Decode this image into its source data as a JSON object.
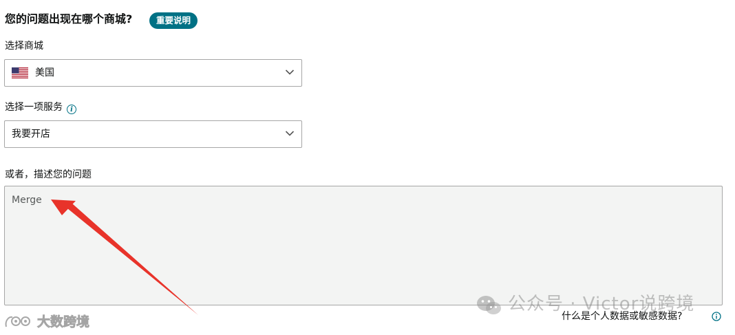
{
  "header": {
    "question": "您的问题出现在哪个商城?",
    "important_button": "重要说明"
  },
  "store": {
    "label": "选择商城",
    "selected": "美国",
    "flag_icon": "us-flag-icon"
  },
  "service": {
    "label": "选择一项服务",
    "selected": "我要开店",
    "info_icon": "info-icon"
  },
  "description": {
    "label": "或者，描述您的问题",
    "value": "Merge"
  },
  "footer": {
    "privacy_link": "什么是个人数据或敏感数据?"
  },
  "watermarks": {
    "wechat": "公众号 · Victor说跨境",
    "bottom": "大数跨境"
  },
  "colors": {
    "accent": "#007185",
    "annotation_arrow": "#e8332a",
    "textarea_bg": "#f3f4f3",
    "border": "#a6a6a6"
  }
}
